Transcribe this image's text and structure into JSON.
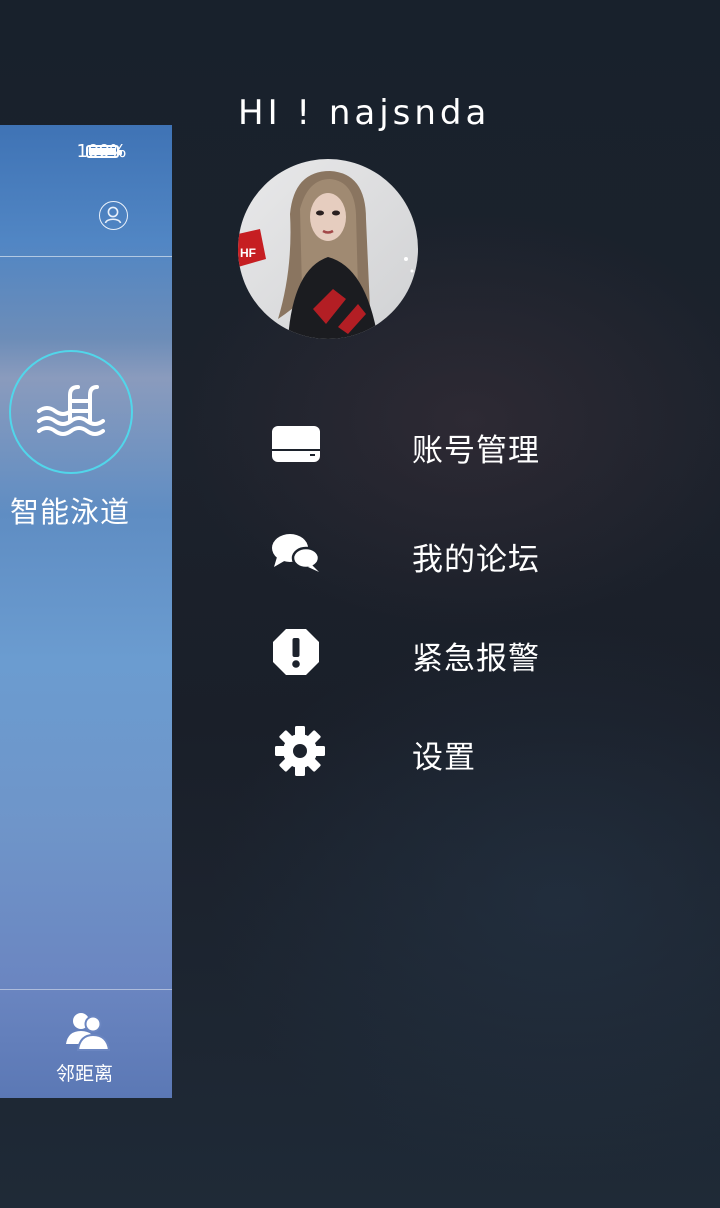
{
  "app_preview": {
    "battery_percent": "100%",
    "feature_label": "智能泳道",
    "bottom_tab_label": "邻距离",
    "accent_color": "#51d6ea"
  },
  "drawer": {
    "greeting": "HI ! najsnda",
    "menu": [
      {
        "label": "账号管理",
        "icon": "card-icon"
      },
      {
        "label": "我的论坛",
        "icon": "chat-bubbles-icon"
      },
      {
        "label": "紧急报警",
        "icon": "alert-octagon-icon"
      },
      {
        "label": "设置",
        "icon": "gear-icon"
      }
    ]
  }
}
